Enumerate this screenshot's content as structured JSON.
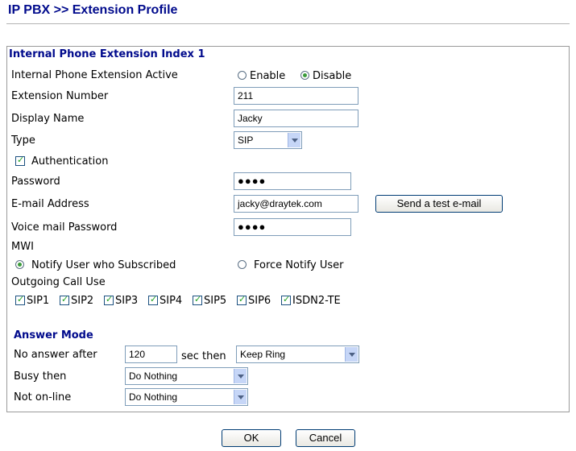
{
  "page": {
    "title": "IP PBX >> Extension Profile"
  },
  "section_ext": {
    "header": "Internal Phone Extension Index 1",
    "active_label": "Internal Phone Extension Active",
    "enable_label": "Enable",
    "disable_label": "Disable",
    "active_value": "Disable",
    "ext_number_label": "Extension Number",
    "ext_number_value": "211",
    "display_name_label": "Display Name",
    "display_name_value": "Jacky",
    "type_label": "Type",
    "type_value": "SIP",
    "auth_label": "Authentication",
    "auth_checked": true,
    "password_label": "Password",
    "password_mask": "●●●●",
    "email_label": "E-mail Address",
    "email_value": "jacky@draytek.com",
    "send_test_label": "Send a test e-mail",
    "vm_password_label": "Voice mail Password",
    "vm_password_mask": "●●●●",
    "mwi_label": "MWI",
    "notify_subscribed_label": "Notify User who Subscribed",
    "force_notify_label": "Force Notify User",
    "mwi_value": "Notify User who Subscribed",
    "outgoing_label": "Outgoing Call Use",
    "outgoing": [
      {
        "label": "SIP1",
        "checked": true
      },
      {
        "label": "SIP2",
        "checked": true
      },
      {
        "label": "SIP3",
        "checked": true
      },
      {
        "label": "SIP4",
        "checked": true
      },
      {
        "label": "SIP5",
        "checked": true
      },
      {
        "label": "SIP6",
        "checked": true
      },
      {
        "label": "ISDN2-TE",
        "checked": true
      }
    ]
  },
  "answer_mode": {
    "header": "Answer Mode",
    "no_answer_label": "No answer after",
    "no_answer_value": "120",
    "sec_then_label": "sec then",
    "no_answer_action": "Keep Ring",
    "busy_label": "Busy then",
    "busy_action": "Do Nothing",
    "not_online_label": "Not on-line",
    "not_online_action": "Do Nothing"
  },
  "buttons": {
    "ok": "OK",
    "cancel": "Cancel"
  },
  "colors": {
    "header_blue": "#000a8c",
    "check_green": "#21a121",
    "input_border": "#7f9db9"
  }
}
